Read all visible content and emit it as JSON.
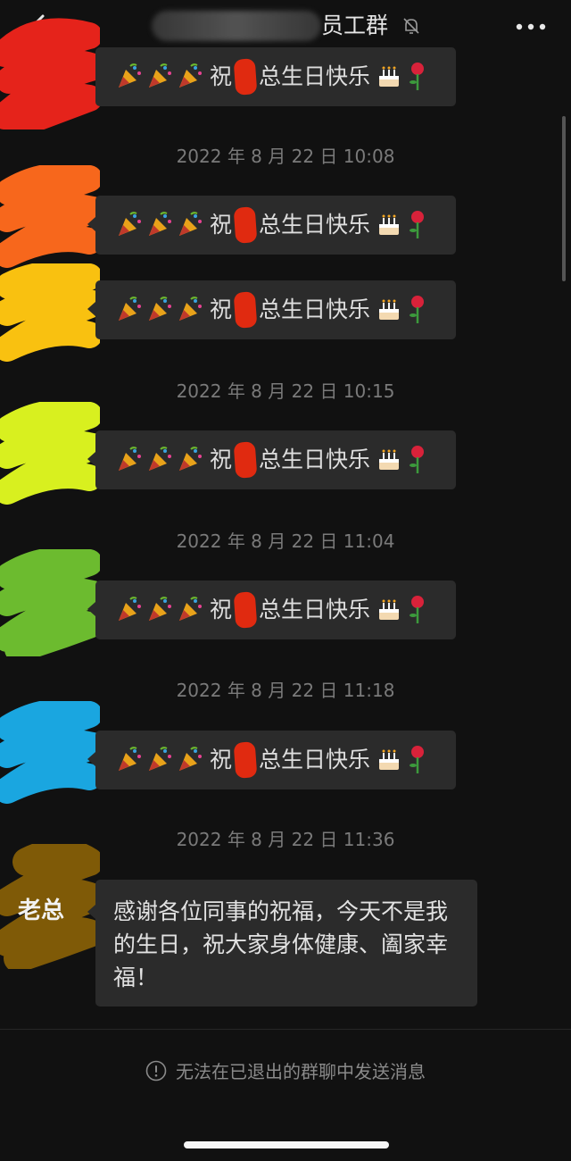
{
  "header": {
    "title_visible": "员工群",
    "back_icon": "chevron-left-icon",
    "mute_icon": "bell-off-icon",
    "more_icon": "more-dots-icon"
  },
  "messages": [
    {
      "type": "greeting",
      "prefix": "祝",
      "suffix": "总生日快乐"
    },
    {
      "type": "timestamp",
      "text": "2022 年 8 月 22 日 10:08"
    },
    {
      "type": "greeting",
      "prefix": "祝",
      "suffix": "总生日快乐"
    },
    {
      "type": "greeting",
      "prefix": "祝",
      "suffix": "总生日快乐"
    },
    {
      "type": "timestamp",
      "text": "2022 年 8 月 22 日 10:15"
    },
    {
      "type": "greeting",
      "prefix": "祝",
      "suffix": "总生日快乐"
    },
    {
      "type": "timestamp",
      "text": "2022 年 8 月 22 日 11:04"
    },
    {
      "type": "greeting",
      "prefix": "祝",
      "suffix": "总生日快乐"
    },
    {
      "type": "timestamp",
      "text": "2022 年 8 月 22 日 11:18"
    },
    {
      "type": "greeting",
      "prefix": "祝",
      "suffix": "总生日快乐"
    },
    {
      "type": "timestamp",
      "text": "2022 年 8 月 22 日 11:36"
    }
  ],
  "boss": {
    "name": "老总",
    "message": "感谢各位同事的祝福，今天不是我的生日，祝大家身体健康、阖家幸福！"
  },
  "avatar_colors": [
    "#e5231b",
    "#f7671c",
    "#f9c110",
    "#d8f01f",
    "#6cbb2f",
    "#1aa6e0",
    "#7f5a07"
  ],
  "footer": {
    "notice": "无法在已退出的群聊中发送消息",
    "notice_icon": "exclamation-circle-icon"
  }
}
